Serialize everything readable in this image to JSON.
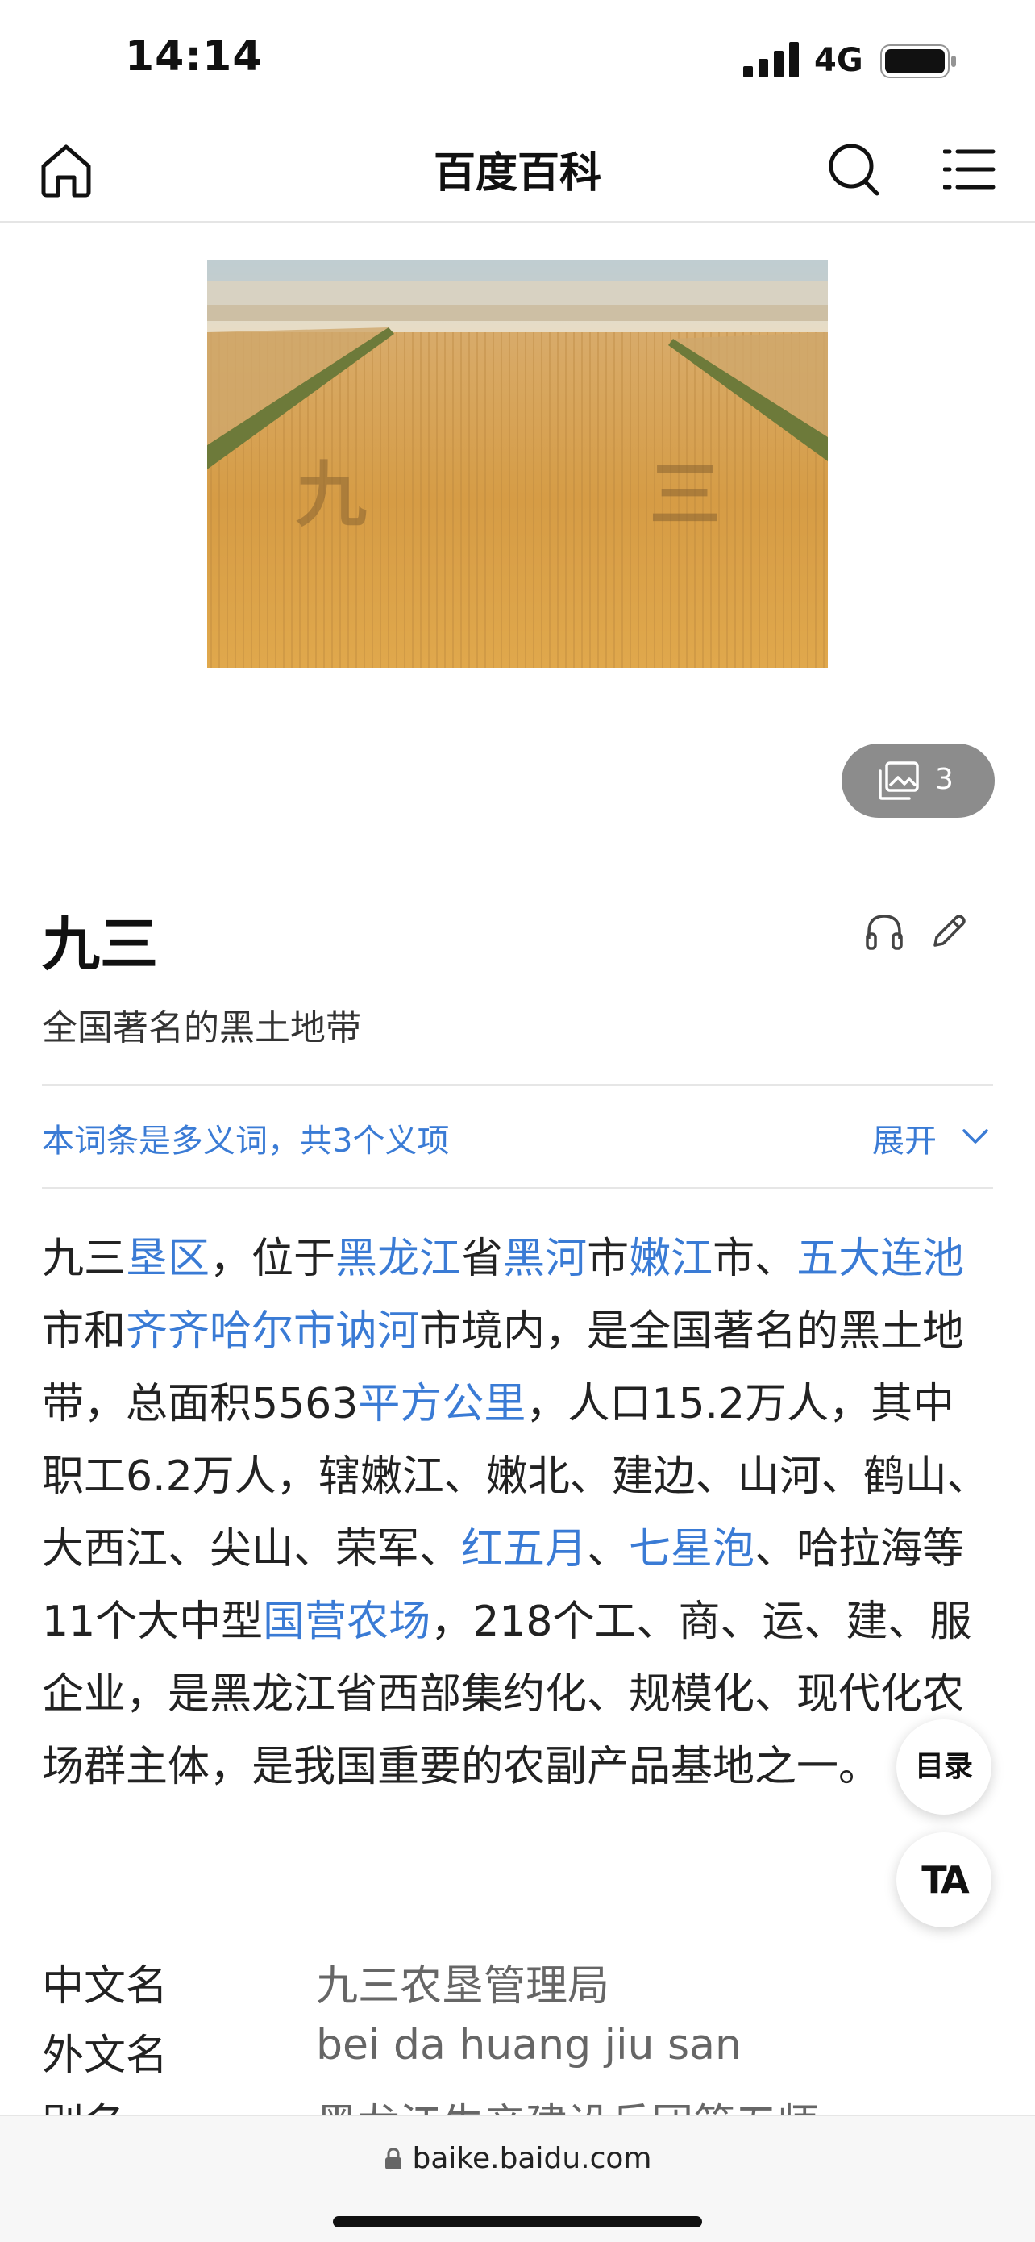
{
  "status_bar": {
    "time": "14:14",
    "network": "4G"
  },
  "nav": {
    "title": "百度百科",
    "icons": [
      "home-icon",
      "search-icon",
      "menu-icon"
    ]
  },
  "hero": {
    "field_text": "九 三"
  },
  "gallery": {
    "count": "3"
  },
  "entry": {
    "title": "九三",
    "subtitle": "全国著名的黑土地带",
    "polysemy_text": "本词条是多义词，共3个义项",
    "expand_label": "展开"
  },
  "paragraph": [
    {
      "t": "九三",
      "link": false
    },
    {
      "t": "垦区",
      "link": true
    },
    {
      "t": "，位于",
      "link": false
    },
    {
      "t": "黑龙江",
      "link": true
    },
    {
      "t": "省",
      "link": false
    },
    {
      "t": "黑河",
      "link": true
    },
    {
      "t": "市",
      "link": false
    },
    {
      "t": "嫩江",
      "link": true
    },
    {
      "t": "市、",
      "link": false
    },
    {
      "t": "五大连池",
      "link": true
    },
    {
      "t": "市和",
      "link": false
    },
    {
      "t": "齐齐哈尔市讷河",
      "link": true
    },
    {
      "t": "市境内，是全国著名的黑土地带，总面积5563",
      "link": false
    },
    {
      "t": "平方公里",
      "link": true
    },
    {
      "t": "，人口15.2万人，其中职工6.2万人，辖嫩江、嫩北、建边、山河、鹤山、大西江、尖山、荣军、",
      "link": false
    },
    {
      "t": "红五月",
      "link": true
    },
    {
      "t": "、",
      "link": false
    },
    {
      "t": "七星泡",
      "link": true
    },
    {
      "t": "、哈拉海等11个大中型",
      "link": false
    },
    {
      "t": "国营农场",
      "link": true
    },
    {
      "t": "，218个工、商、运、建、服企业，是黑龙江省西部集约化、规模化、现代化农场群主体，是我国重要的农副产品基地之一。",
      "link": false
    }
  ],
  "floating": {
    "toc_label": "目录",
    "ta_label": "TA"
  },
  "info": [
    {
      "label": "中文名",
      "value": "九三农垦管理局"
    },
    {
      "label": "外文名",
      "value": "bei da huang jiu san"
    },
    {
      "label": "别名",
      "value": "黑龙江生产建设兵团第五师"
    }
  ],
  "bottom": {
    "url": "baike.baidu.com"
  },
  "colors": {
    "link": "#3a7bd5",
    "field": "#d9a04a"
  }
}
